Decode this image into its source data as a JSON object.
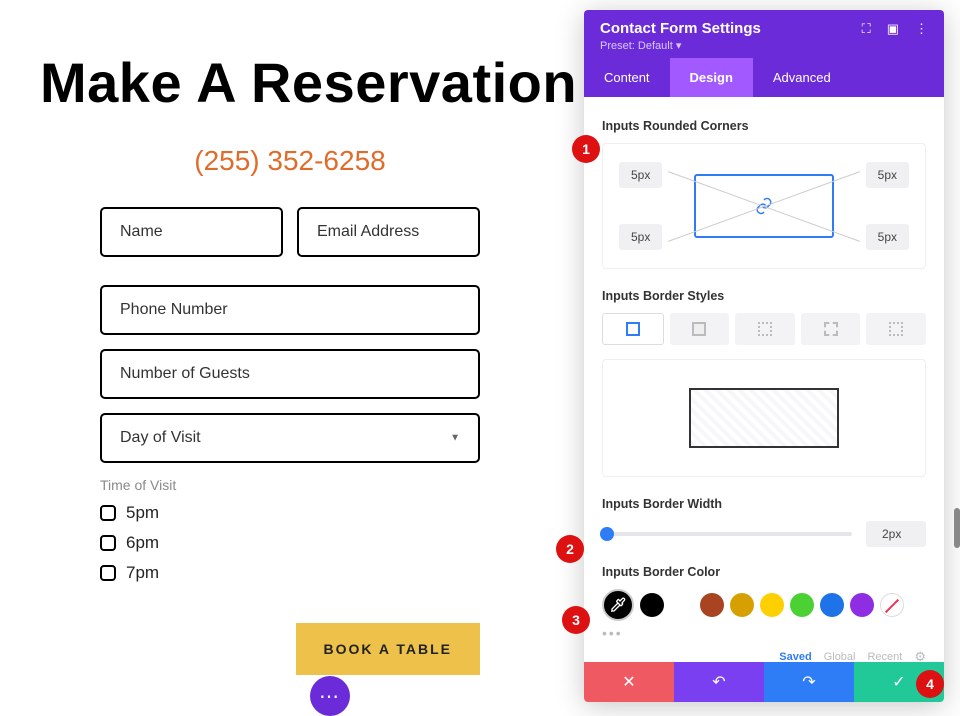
{
  "page": {
    "heading": "Make A Reservation",
    "phone": "(255) 352-6258",
    "fields": {
      "name": "Name",
      "email": "Email Address",
      "phone": "Phone Number",
      "guests": "Number of Guests",
      "day": "Day of Visit"
    },
    "time_label": "Time of Visit",
    "time_options": [
      "5pm",
      "6pm",
      "7pm"
    ],
    "submit": "BOOK A TABLE",
    "fab": "⋯"
  },
  "panel": {
    "title": "Contact Form Settings",
    "preset": "Preset: Default ▾",
    "tabs": {
      "content": "Content",
      "design": "Design",
      "advanced": "Advanced"
    },
    "sections": {
      "corners": {
        "label": "Inputs Rounded Corners",
        "tl": "5px",
        "tr": "5px",
        "bl": "5px",
        "br": "5px"
      },
      "border_styles": {
        "label": "Inputs Border Styles"
      },
      "border_width": {
        "label": "Inputs Border Width",
        "value": "2px"
      },
      "border_color": {
        "label": "Inputs Border Color"
      }
    },
    "color_tabs": {
      "saved": "Saved",
      "global": "Global",
      "recent": "Recent"
    },
    "swatches": [
      "#000000",
      "#ffffff",
      "#a94423",
      "#d6a100",
      "#ffd000",
      "#4bd134",
      "#1e73e8",
      "#8e2de2"
    ]
  },
  "callouts": {
    "1": "1",
    "2": "2",
    "3": "3",
    "4": "4"
  }
}
